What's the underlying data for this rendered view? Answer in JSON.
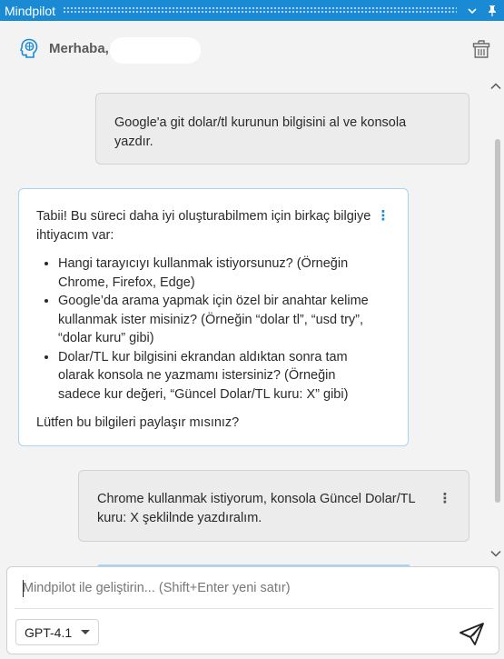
{
  "window": {
    "title": "Mindpilot"
  },
  "header": {
    "greeting": "Merhaba,"
  },
  "messages": [
    {
      "role": "user",
      "text": "Google'a git dolar/tl kurunun bilgisini al ve konsola yazdır."
    },
    {
      "role": "assistant",
      "intro": "Tabii! Bu süreci daha iyi oluşturabilmem için birkaç bilgiye ihtiyacım var:",
      "bullets": [
        "Hangi tarayıcıyı kullanmak istiyorsunuz? (Örneğin Chrome, Firefox, Edge)",
        "Google’da arama yapmak için özel bir anahtar kelime kullanmak ister misiniz? (Örneğin “dolar tl”, “usd try”, “dolar kuru” gibi)",
        "Dolar/TL kur bilgisini ekrandan aldıktan sonra tam olarak konsola ne yazmamı istersiniz? (Örneğin sadece kur değeri, “Güncel Dolar/TL kuru: X” gibi)"
      ],
      "outro": "Lütfen bu bilgileri paylaşır mısınız?"
    },
    {
      "role": "user",
      "text": "Chrome kullanmak istiyorum, konsola Güncel Dolar/TL kuru: X şeklilnde yazdıralım."
    }
  ],
  "composer": {
    "placeholder": "Mindpilot ile geliştirin... (Shift+Enter yeni satır)",
    "value": "",
    "model": "GPT-4.1"
  },
  "colors": {
    "accent": "#1a8ad4",
    "ai_border": "#a8d4f4",
    "user_bubble": "#ececec",
    "background": "#f3f3f3"
  },
  "icons": {
    "titlebar": [
      "chevron-down-icon",
      "pin-icon"
    ],
    "header": [
      "brain-icon",
      "trash-icon"
    ],
    "composer": [
      "send-icon"
    ]
  }
}
